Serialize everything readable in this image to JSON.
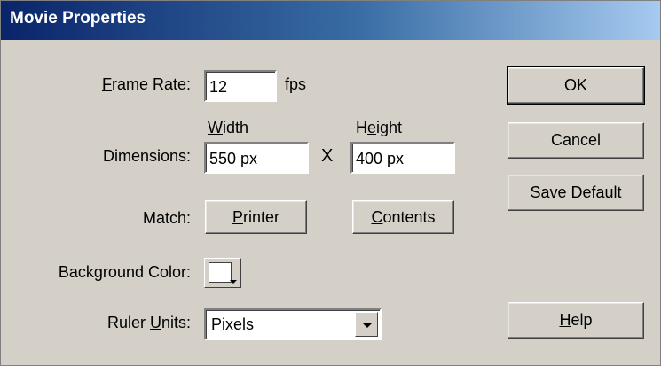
{
  "window": {
    "title": "Movie Properties"
  },
  "frame_rate": {
    "label_access_key": "F",
    "label_rest": "rame Rate:",
    "value": "12",
    "unit": "fps"
  },
  "dimensions": {
    "label": "Dimensions:",
    "width_header_key": "W",
    "width_header_rest": "idth",
    "height_header_pre": "H",
    "height_header_key": "e",
    "height_header_rest": "ight",
    "width_value": "550 px",
    "separator": "X",
    "height_value": "400 px"
  },
  "match": {
    "label": "Match:",
    "printer_key": "P",
    "printer_rest": "rinter",
    "contents_key": "C",
    "contents_rest": "ontents"
  },
  "background": {
    "label": "Background Color:",
    "color": "#ffffff"
  },
  "ruler": {
    "label_pre": "Ruler ",
    "label_key": "U",
    "label_rest": "nits:",
    "selected": "Pixels"
  },
  "buttons": {
    "ok": "OK",
    "cancel": "Cancel",
    "save_default": "Save Default",
    "help_key": "H",
    "help_rest": "elp"
  }
}
